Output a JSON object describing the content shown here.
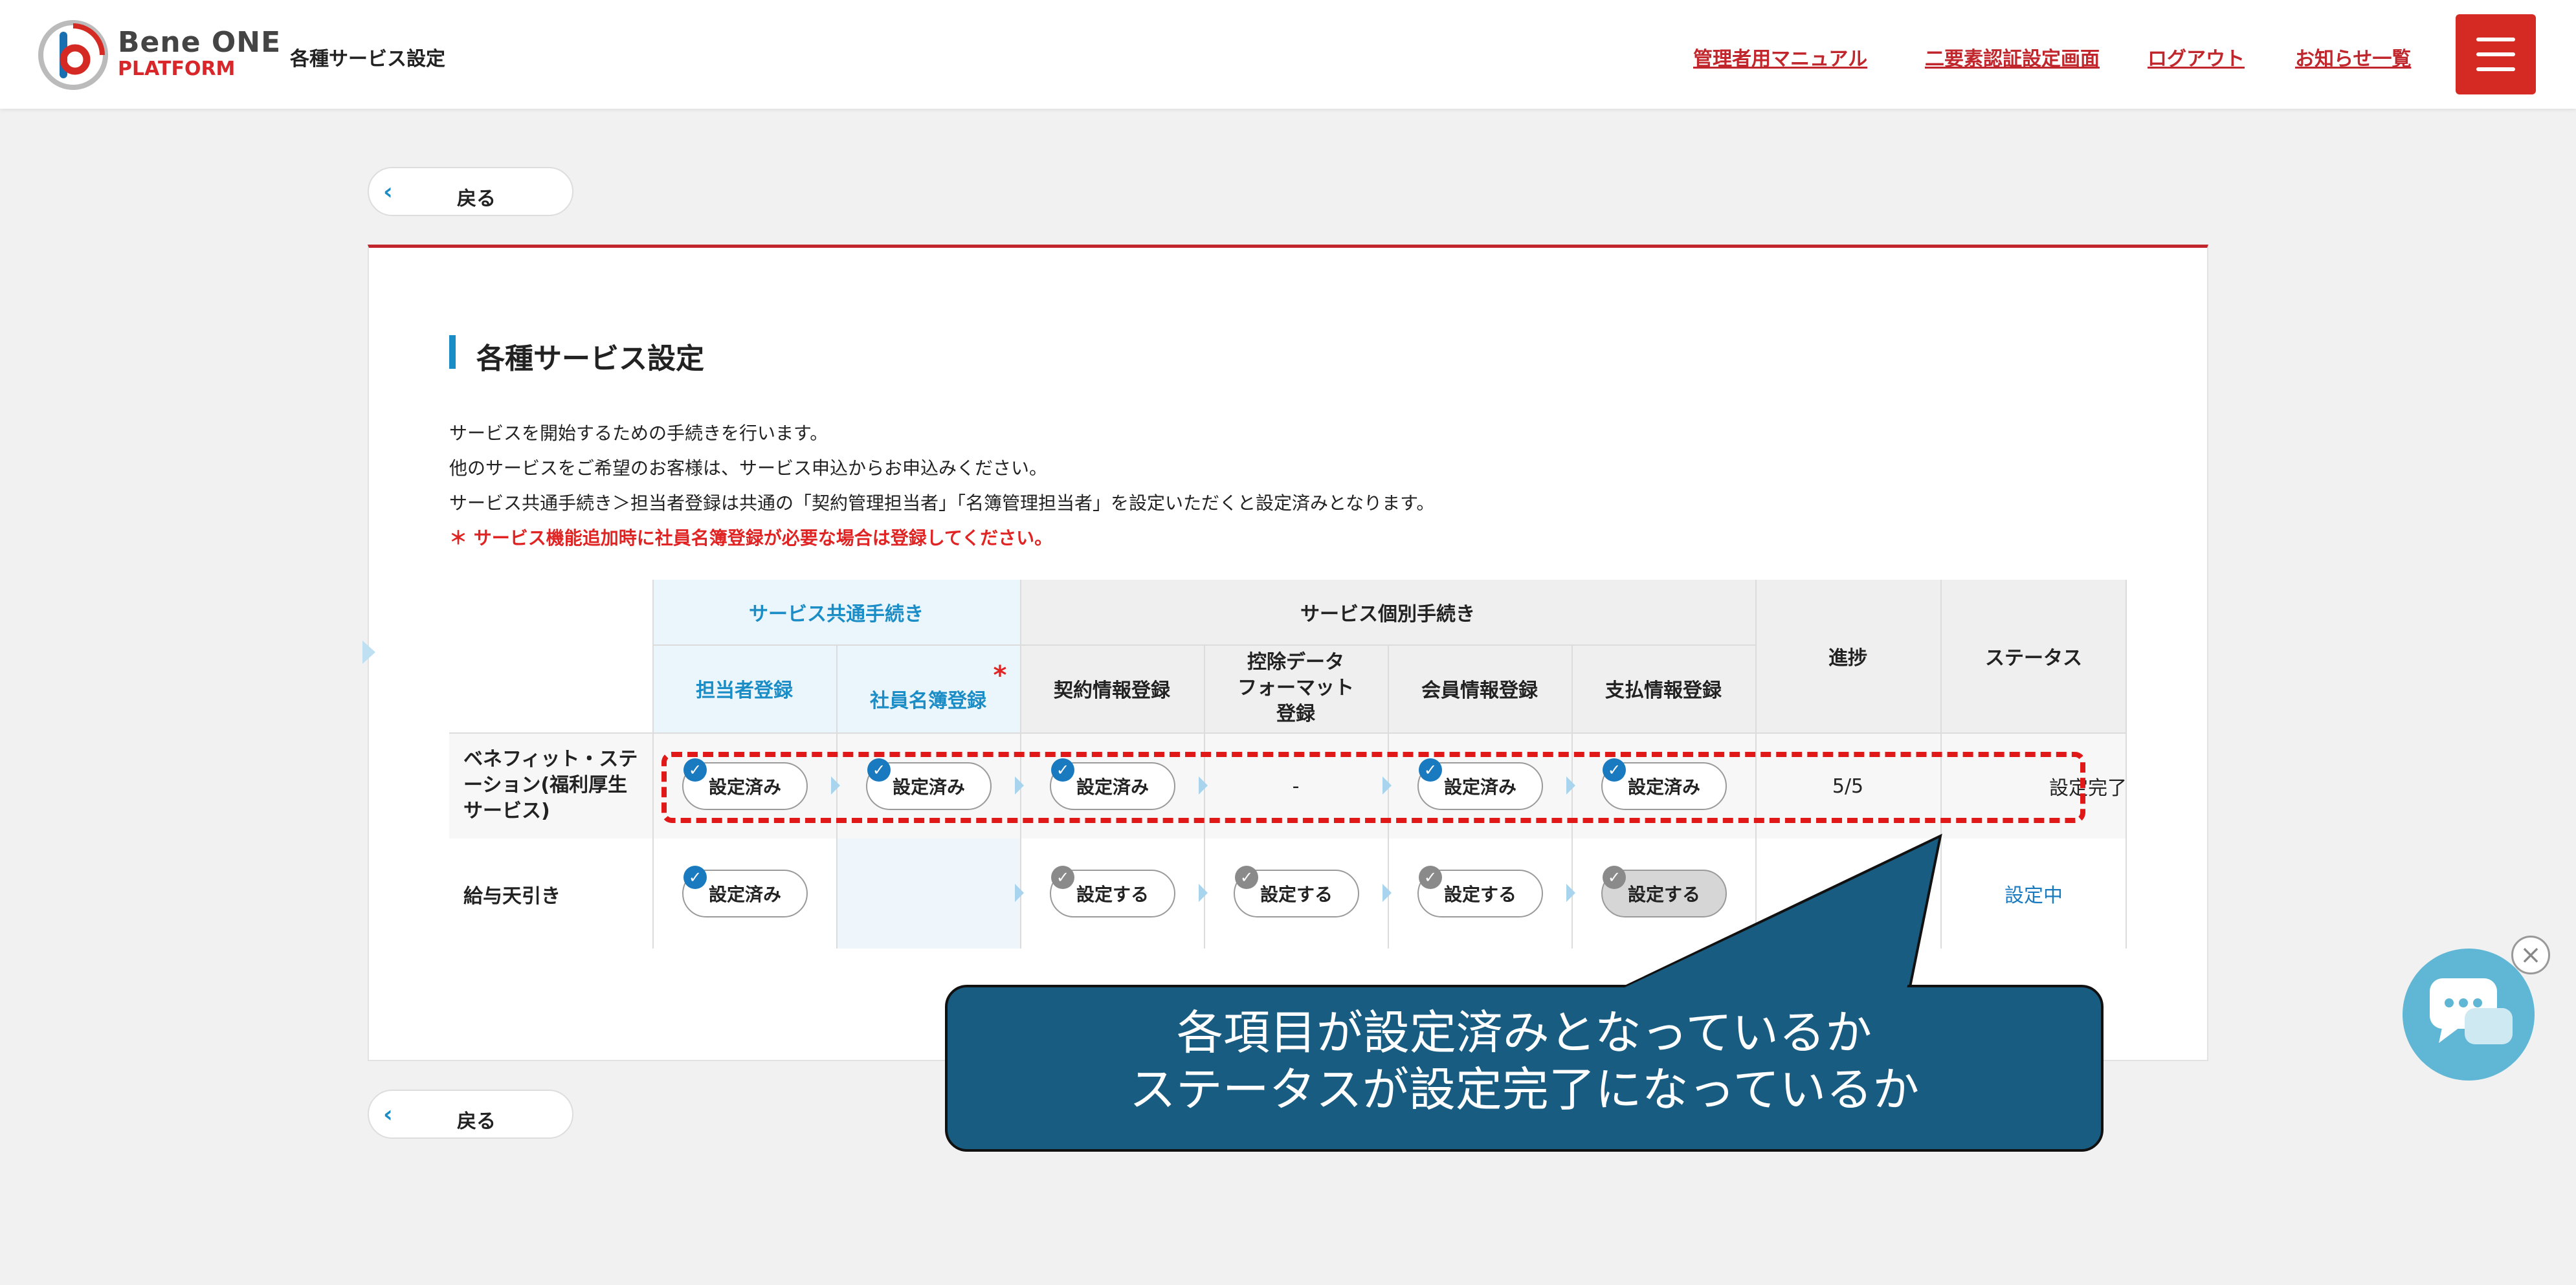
{
  "header": {
    "brand_line1": "Bene ONE",
    "brand_line2": "PLATFORM",
    "page_title": "各種サービス設定",
    "nav": [
      "管理者用マニュアル",
      "二要素認証設定画面",
      "ログアウト",
      "お知らせ一覧"
    ],
    "menu_icon": "hamburger-icon"
  },
  "back_button_label": "戻る",
  "section": {
    "title": "各種サービス設定",
    "lines": [
      "サービスを開始するための手続きを行います。",
      "他のサービスをご希望のお客様は、サービス申込からお申込みください。",
      "サービス共通手続き＞担当者登録は共通の「契約管理担当者」「名簿管理担当者」を設定いただくと設定済みとなります。"
    ],
    "note": "＊ サービス機能追加時に社員名簿登録が必要な場合は登録してください。"
  },
  "table": {
    "group_common": "サービス共通手続き",
    "group_individual": "サービス個別手続き",
    "col_progress": "進捗",
    "col_status": "ステータス",
    "cols": [
      "担当者登録",
      "社員名簿登録",
      "契約情報登録",
      "控除データ\nフォーマット\n登録",
      "会員情報登録",
      "支払情報登録"
    ],
    "required_mark": "*",
    "rows": [
      {
        "name": "ベネフィット・ステーション(福利厚生サービス)",
        "name_lines": [
          "ベネフィット・ステ",
          "ーション(福利厚生",
          "サービス)"
        ],
        "cells": [
          "設定済み",
          "設定済み",
          "設定済み",
          "-",
          "設定済み",
          "設定済み"
        ],
        "progress": "5/5",
        "status": "設定完了"
      },
      {
        "name": "給与天引き",
        "name_lines": [
          "給与天引き"
        ],
        "cells": [
          "設定済み",
          "",
          "設定する",
          "設定する",
          "設定する",
          "設定する"
        ],
        "progress": "",
        "status": "設定中"
      }
    ]
  },
  "callout": {
    "line1": "各項目が設定済みとなっているか",
    "line2": "ステータスが設定完了になっているか"
  },
  "colors": {
    "accent_red": "#d52a23",
    "accent_blue": "#1a8cc6",
    "callout_bg": "#185d81",
    "common_header_bg": "#eaf5fc"
  }
}
